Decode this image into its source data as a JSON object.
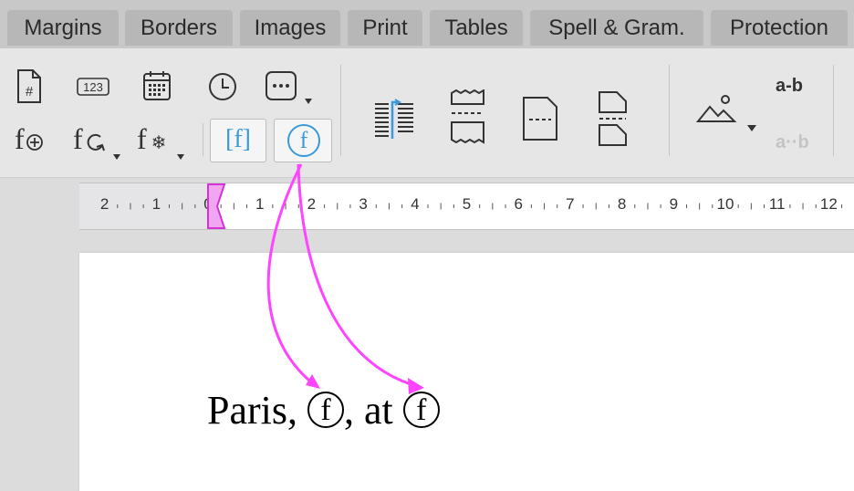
{
  "tabs": [
    "Margins",
    "Borders",
    "Images",
    "Print",
    "Tables",
    "Spell & Gram.",
    "Protection"
  ],
  "toolbar": {
    "row1": [
      "page-number-icon",
      "numbering-icon",
      "date-icon",
      "time-icon",
      "more-fields-icon"
    ],
    "row2": [
      "insert-field-icon",
      "update-fields-icon",
      "freeze-fields-icon",
      "show-field-codes-icon",
      "show-field-shading-icon"
    ],
    "numbering_label": "123",
    "field_code_label": "[f]",
    "field_shading_label": "f",
    "hyphen_label": "a-b",
    "hyphen_disabled_label": "a··b"
  },
  "ruler": {
    "labels": [
      "2",
      "1",
      "0",
      "1",
      "2",
      "3",
      "4",
      "5",
      "6",
      "7",
      "8",
      "9",
      "10",
      "11",
      "12"
    ]
  },
  "document": {
    "text_before": "Paris, ",
    "field1": "f",
    "text_middle": ", at ",
    "field2": "f"
  },
  "colors": {
    "accent_blue": "#3a9ad9",
    "annotation_magenta": "#ff44ff"
  }
}
